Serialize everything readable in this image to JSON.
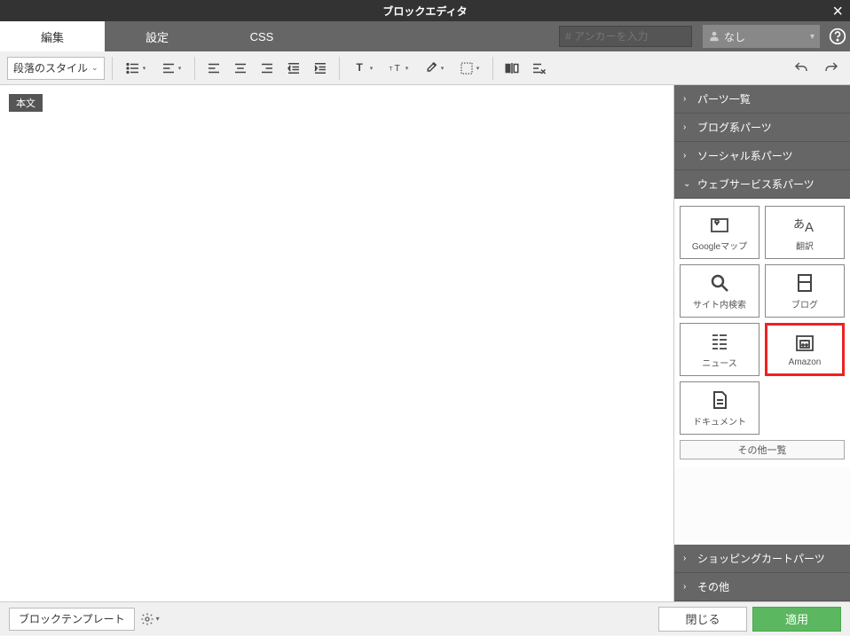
{
  "titlebar": {
    "title": "ブロックエディタ"
  },
  "tabs": {
    "edit": "編集",
    "settings": "設定",
    "css": "CSS"
  },
  "anchor_placeholder": "# アンカーを入力",
  "anim_select": {
    "icon": "person",
    "label": "なし"
  },
  "toolbar": {
    "style_dd": "段落のスタイル"
  },
  "canvas": {
    "content_label": "本文"
  },
  "sidepanel": {
    "sections": [
      {
        "label": "パーツ一覧",
        "open": false
      },
      {
        "label": "ブログ系パーツ",
        "open": false
      },
      {
        "label": "ソーシャル系パーツ",
        "open": false
      },
      {
        "label": "ウェブサービス系パーツ",
        "open": true
      },
      {
        "label": "ショッピングカートパーツ",
        "open": false
      },
      {
        "label": "その他",
        "open": false
      }
    ],
    "parts": [
      {
        "label": "Googleマップ",
        "icon": "map"
      },
      {
        "label": "翻訳",
        "icon": "translate"
      },
      {
        "label": "サイト内検索",
        "icon": "search"
      },
      {
        "label": "ブログ",
        "icon": "blog"
      },
      {
        "label": "ニュース",
        "icon": "news"
      },
      {
        "label": "Amazon",
        "icon": "amazon",
        "highlighted": true
      },
      {
        "label": "ドキュメント",
        "icon": "doc"
      }
    ],
    "other_list": "その他一覧"
  },
  "footer": {
    "template": "ブロックテンプレート",
    "close": "閉じる",
    "apply": "適用"
  }
}
